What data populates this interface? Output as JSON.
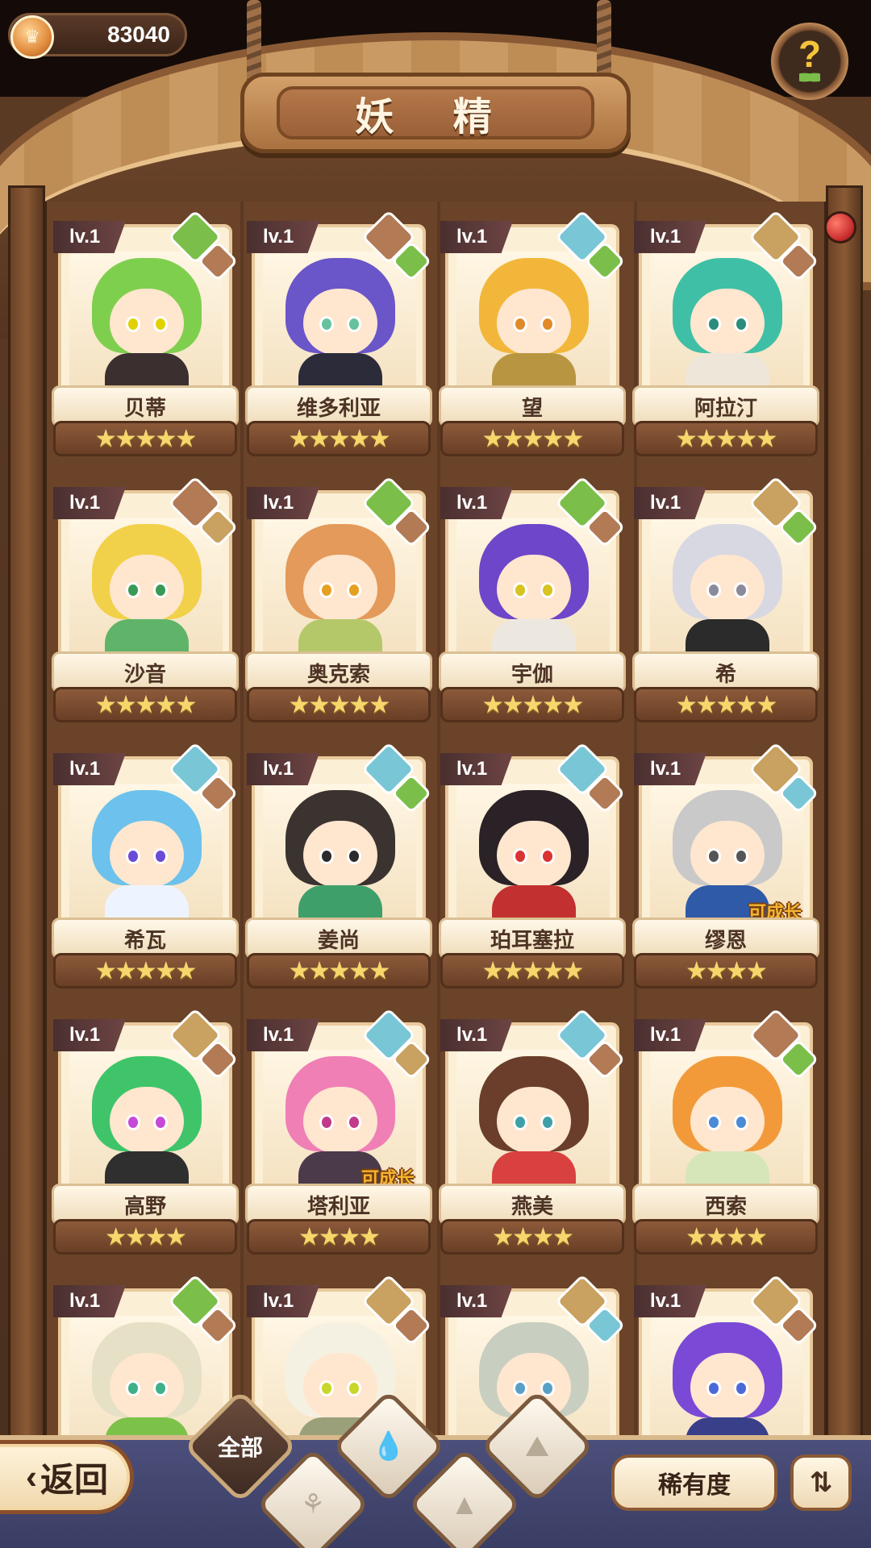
{
  "currency": {
    "value": "83040",
    "icon": "coin-icon"
  },
  "title": "妖 精",
  "help": {
    "label": "?",
    "icon": "sprout-icon"
  },
  "colors": {
    "water": "#79c6d6",
    "earth": "#c9a160",
    "rock": "#b27a55",
    "plant": "#7bbf4a",
    "star": "#f7d66b"
  },
  "fairies": [
    {
      "level": "lv.1",
      "name": "贝蒂",
      "stars": "★★★★★",
      "elements": [
        "plant",
        "rock"
      ],
      "hair": "#7fcf4e",
      "body": "#3b2f2f",
      "eye": "#e0d200",
      "growable": ""
    },
    {
      "level": "lv.1",
      "name": "维多利亚",
      "stars": "★★★★★",
      "elements": [
        "rock",
        "plant"
      ],
      "hair": "#6a55c9",
      "body": "#2b2b3a",
      "eye": "#66c29e",
      "growable": ""
    },
    {
      "level": "lv.1",
      "name": "望",
      "stars": "★★★★★",
      "elements": [
        "water",
        "plant"
      ],
      "hair": "#f2b73a",
      "body": "#b89540",
      "eye": "#e08a2a",
      "growable": ""
    },
    {
      "level": "lv.1",
      "name": "阿拉汀",
      "stars": "★★★★★",
      "elements": [
        "earth",
        "rock"
      ],
      "hair": "#3fc0a6",
      "body": "#efe6da",
      "eye": "#2a8c7a",
      "growable": ""
    },
    {
      "level": "lv.1",
      "name": "沙音",
      "stars": "★★★★★",
      "elements": [
        "rock",
        "earth"
      ],
      "hair": "#f2d14a",
      "body": "#5fb46a",
      "eye": "#3a9a55",
      "growable": ""
    },
    {
      "level": "lv.1",
      "name": "奥克索",
      "stars": "★★★★★",
      "elements": [
        "plant",
        "rock"
      ],
      "hair": "#e39a5a",
      "body": "#b4c86a",
      "eye": "#e6a021",
      "growable": ""
    },
    {
      "level": "lv.1",
      "name": "宇伽",
      "stars": "★★★★★",
      "elements": [
        "plant",
        "rock"
      ],
      "hair": "#6e46c9",
      "body": "#ece8e0",
      "eye": "#d8c320",
      "growable": ""
    },
    {
      "level": "lv.1",
      "name": "希",
      "stars": "★★★★★",
      "elements": [
        "earth",
        "plant"
      ],
      "hair": "#d8d8e2",
      "body": "#2b2b2b",
      "eye": "#8a8a9a",
      "growable": ""
    },
    {
      "level": "lv.1",
      "name": "希瓦",
      "stars": "★★★★★",
      "elements": [
        "water",
        "rock"
      ],
      "hair": "#6cc2ec",
      "body": "#eef4ff",
      "eye": "#6a4ad6",
      "growable": ""
    },
    {
      "level": "lv.1",
      "name": "姜尚",
      "stars": "★★★★★",
      "elements": [
        "water",
        "plant"
      ],
      "hair": "#3a3330",
      "body": "#3f9f6a",
      "eye": "#2b2b2b",
      "growable": ""
    },
    {
      "level": "lv.1",
      "name": "珀耳塞拉",
      "stars": "★★★★★",
      "elements": [
        "water",
        "rock"
      ],
      "hair": "#2a2226",
      "body": "#c23030",
      "eye": "#d93333",
      "growable": ""
    },
    {
      "level": "lv.1",
      "name": "缪恩",
      "stars": "★★★★",
      "elements": [
        "earth",
        "water"
      ],
      "hair": "#c9c9c9",
      "body": "#2f5aa8",
      "eye": "#555555",
      "growable": "可成长"
    },
    {
      "level": "lv.1",
      "name": "高野",
      "stars": "★★★★",
      "elements": [
        "earth",
        "rock"
      ],
      "hair": "#3fc46a",
      "body": "#2f2f2f",
      "eye": "#c54ad8",
      "growable": ""
    },
    {
      "level": "lv.1",
      "name": "塔利亚",
      "stars": "★★★★",
      "elements": [
        "water",
        "earth"
      ],
      "hair": "#f07fb6",
      "body": "#4a3a4a",
      "eye": "#c23a8a",
      "growable": "可成长"
    },
    {
      "level": "lv.1",
      "name": "燕美",
      "stars": "★★★★",
      "elements": [
        "water",
        "rock"
      ],
      "hair": "#6a3e2a",
      "body": "#d94040",
      "eye": "#3fa0a8",
      "growable": ""
    },
    {
      "level": "lv.1",
      "name": "西索",
      "stars": "★★★★",
      "elements": [
        "rock",
        "plant"
      ],
      "hair": "#f29a3a",
      "body": "#d6e6b8",
      "eye": "#4a8ad6",
      "growable": ""
    },
    {
      "level": "lv.1",
      "name": "",
      "stars": "",
      "elements": [
        "plant",
        "rock"
      ],
      "hair": "#e6e0c6",
      "body": "#7cc24a",
      "eye": "#3fb08a",
      "growable": ""
    },
    {
      "level": "lv.1",
      "name": "",
      "stars": "",
      "elements": [
        "earth",
        "rock"
      ],
      "hair": "#f5f1e2",
      "body": "#9aa07a",
      "eye": "#c9d62a",
      "growable": ""
    },
    {
      "level": "lv.1",
      "name": "",
      "stars": "",
      "elements": [
        "earth",
        "water"
      ],
      "hair": "#c9cfc0",
      "body": "#e8e6df",
      "eye": "#5aa0c6",
      "growable": ""
    },
    {
      "level": "lv.1",
      "name": "",
      "stars": "",
      "elements": [
        "earth",
        "rock"
      ],
      "hair": "#7a4ad6",
      "body": "#3a3f8a",
      "eye": "#4a6ad8",
      "growable": ""
    }
  ],
  "bottom": {
    "back_label": "返回",
    "filters": [
      {
        "label": "全部",
        "icon": "all-icon",
        "active": true
      },
      {
        "label": "",
        "icon": "sprout-icon",
        "active": false
      },
      {
        "label": "",
        "icon": "water-drop-icon",
        "active": false
      },
      {
        "label": "",
        "icon": "mountain-icon",
        "active": false
      },
      {
        "label": "",
        "icon": "rock-icon",
        "active": false
      }
    ],
    "sort_label": "稀有度",
    "sort_icon": "sort-order-icon"
  }
}
